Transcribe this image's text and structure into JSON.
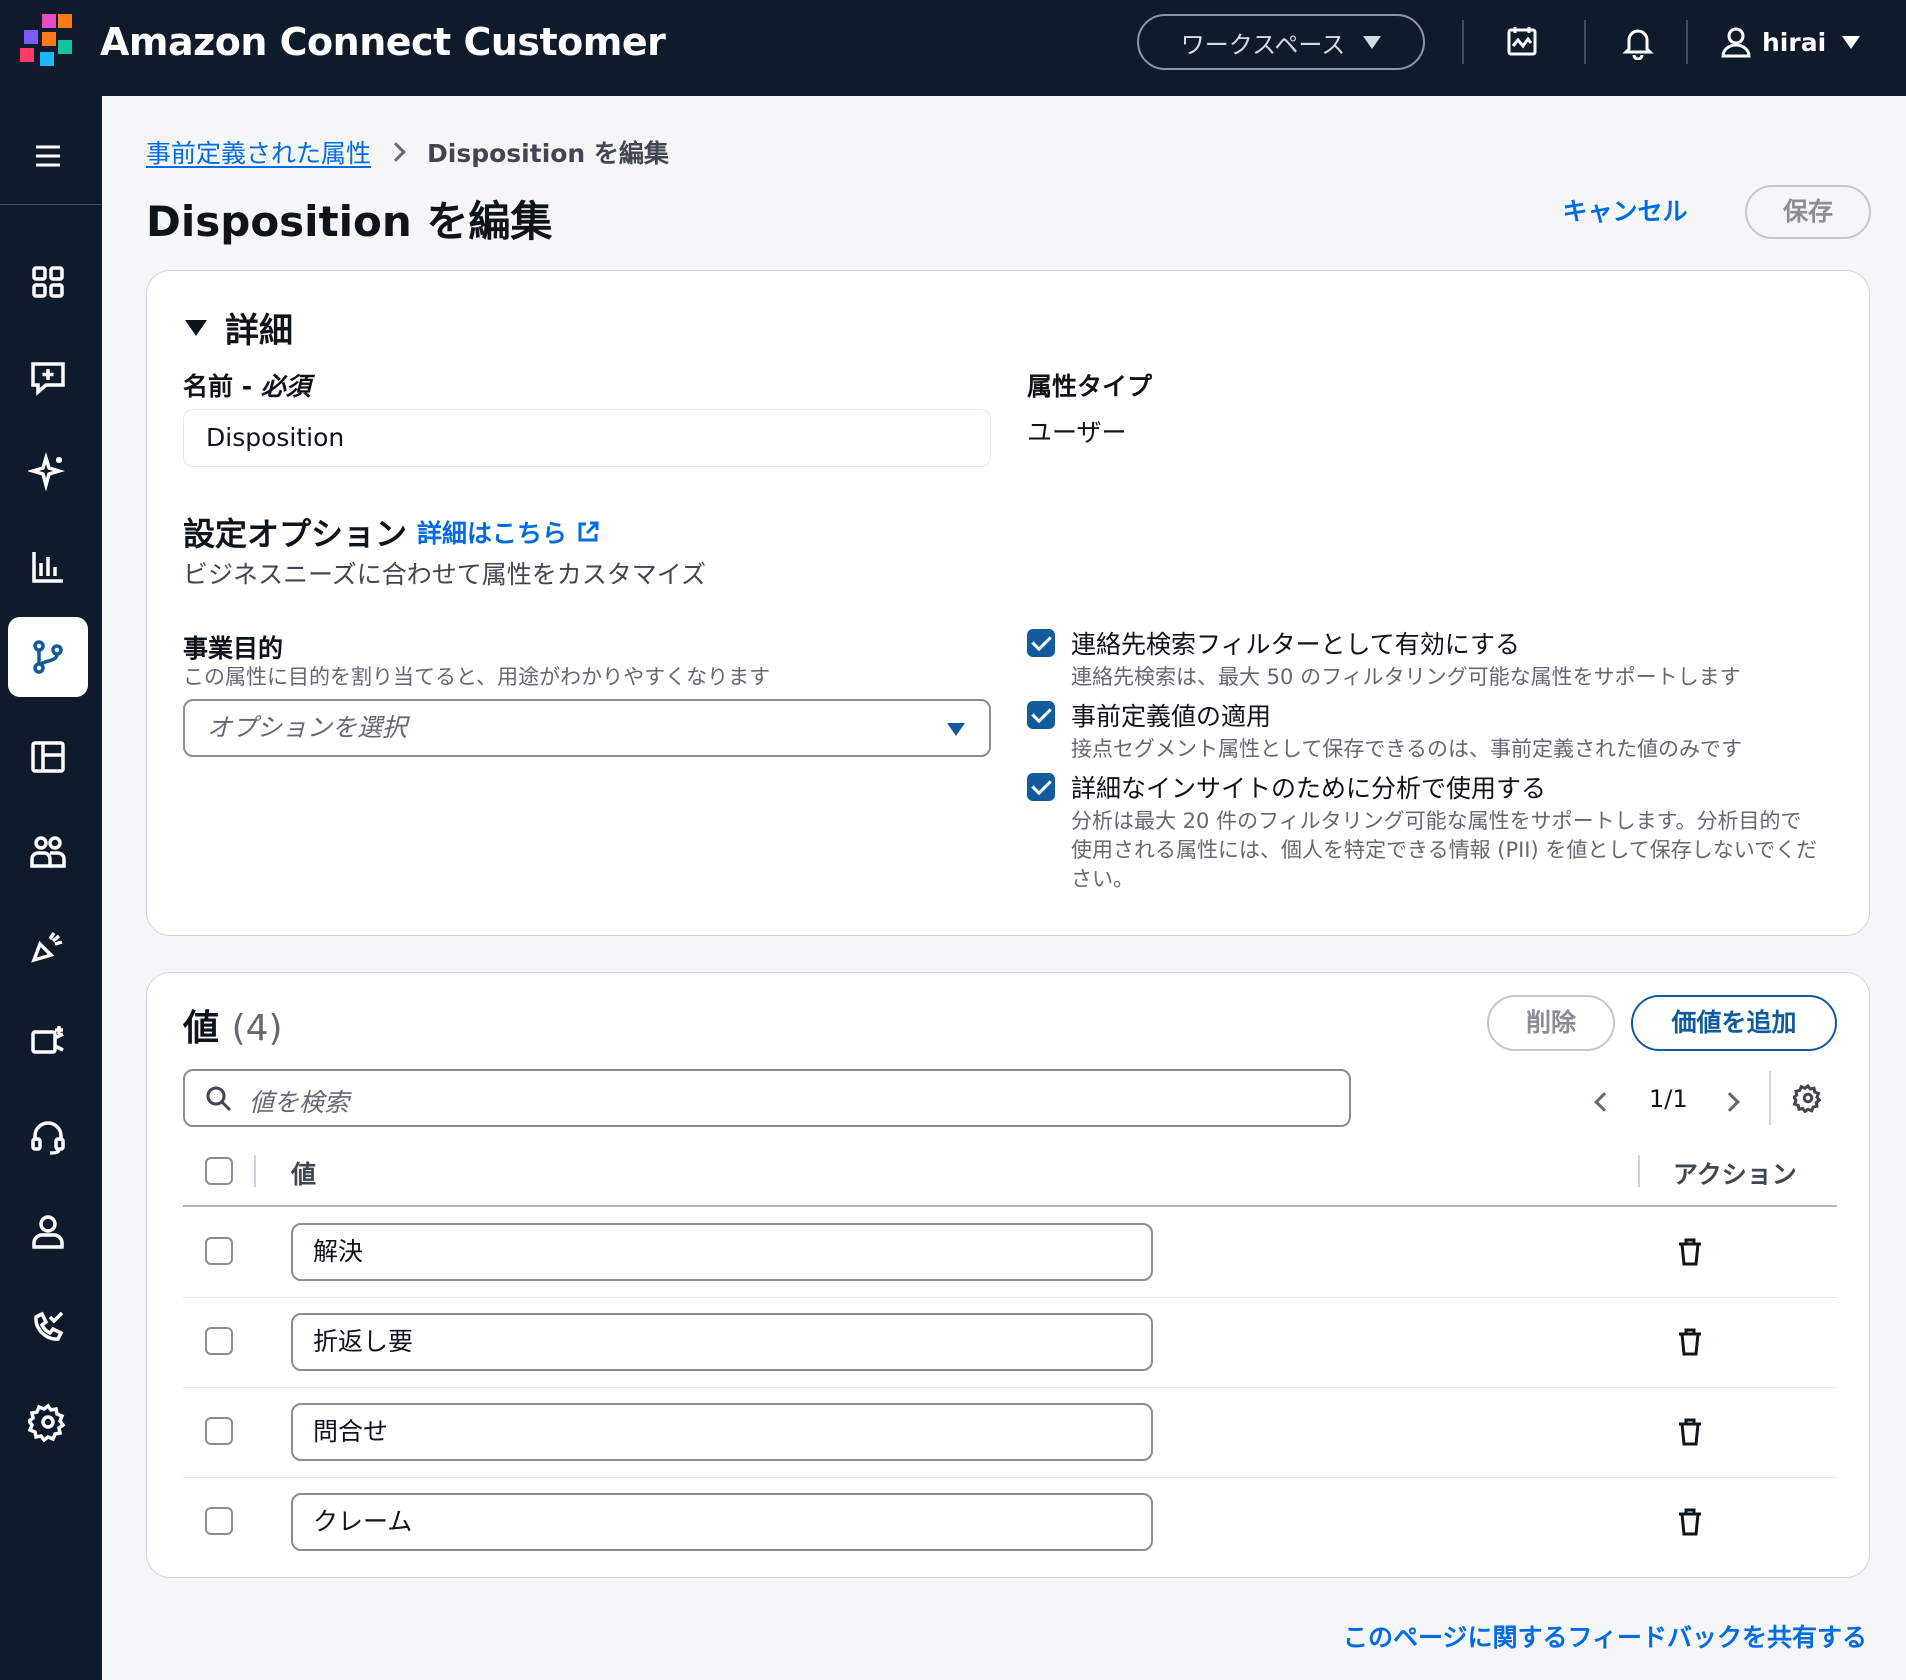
{
  "header": {
    "app_title": "Amazon Connect Customer",
    "workspace_label": "ワークスペース",
    "user_name": "hirai"
  },
  "breadcrumb": {
    "parent": "事前定義された属性",
    "current": "Disposition を編集"
  },
  "page": {
    "title": "Disposition を編集",
    "cancel_label": "キャンセル",
    "save_label": "保存"
  },
  "details": {
    "section_title": "詳細",
    "name_label": "名前 - ",
    "name_required": "必須",
    "name_value": "Disposition",
    "attr_type_label": "属性タイプ",
    "attr_type_value": "ユーザー",
    "config_title": "設定オプション",
    "config_link": "詳細はこちら",
    "config_desc": "ビジネスニーズに合わせて属性をカスタマイズ",
    "purpose_label": "事業目的",
    "purpose_desc": "この属性に目的を割り当てると、用途がわかりやすくなります",
    "purpose_placeholder": "オプションを選択",
    "options": [
      {
        "title": "連絡先検索フィルターとして有効にする",
        "desc": "連絡先検索は、最大 50 のフィルタリング可能な属性をサポートします",
        "checked": true
      },
      {
        "title": "事前定義値の適用",
        "desc": "接点セグメント属性として保存できるのは、事前定義された値のみです",
        "checked": true
      },
      {
        "title": "詳細なインサイトのために分析で使用する",
        "desc_lines": [
          "分析は最大 20 件のフィルタリング可能な属性をサポートします。分析目的で",
          "使用される属性には、個人を特定できる情報 (PII) を値として保存しないでくだ",
          "さい。"
        ],
        "checked": true
      }
    ]
  },
  "values": {
    "title": "値",
    "count": "(4)",
    "delete_label": "削除",
    "add_label": "価値を追加",
    "search_placeholder": "値を検索",
    "page_indicator": "1/1",
    "col_value": "値",
    "col_action": "アクション",
    "rows": [
      "解決",
      "折返し要",
      "問合せ",
      "クレーム"
    ]
  },
  "footer": {
    "feedback_link": "このページに関するフィードバックを共有する"
  },
  "colors": {
    "nav_bg": "#0f1b2a",
    "accent": "#0f5b9c",
    "link": "#006ce0"
  }
}
